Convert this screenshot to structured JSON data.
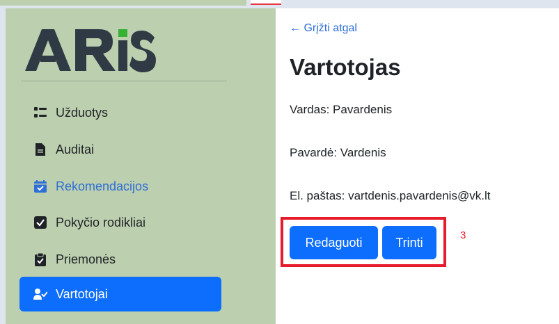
{
  "brand": {
    "logo_text": "ARiS"
  },
  "sidebar": {
    "items": [
      {
        "label": "Užduotys",
        "icon": "tasks-icon",
        "state": "default"
      },
      {
        "label": "Auditai",
        "icon": "file-text-icon",
        "state": "default"
      },
      {
        "label": "Rekomendacijos",
        "icon": "calendar-check-icon",
        "state": "link"
      },
      {
        "label": "Pokyčio rodikliai",
        "icon": "checkbox-checked-icon",
        "state": "default"
      },
      {
        "label": "Priemonės",
        "icon": "clipboard-check-icon",
        "state": "default"
      },
      {
        "label": "Vartotojai",
        "icon": "user-check-icon",
        "state": "active"
      }
    ]
  },
  "main": {
    "back_link": "← Grįžti atgal",
    "title": "Vartotojas",
    "fields": [
      {
        "text": "Vardas: Pavardenis"
      },
      {
        "text": "Pavardė: Vardenis"
      },
      {
        "text": "El. paštas: vartdenis.pavardenis@vk.lt"
      }
    ],
    "actions": {
      "edit_label": "Redaguoti",
      "delete_label": "Trinti"
    }
  },
  "annotation": {
    "label": "3"
  },
  "colors": {
    "sidebar_bg": "#bccfae",
    "accent": "#0d6efd",
    "link": "#2f6fd6",
    "highlight_border": "#e61b2c",
    "logo_text": "#2f3a44",
    "logo_accent": "#34b233"
  }
}
